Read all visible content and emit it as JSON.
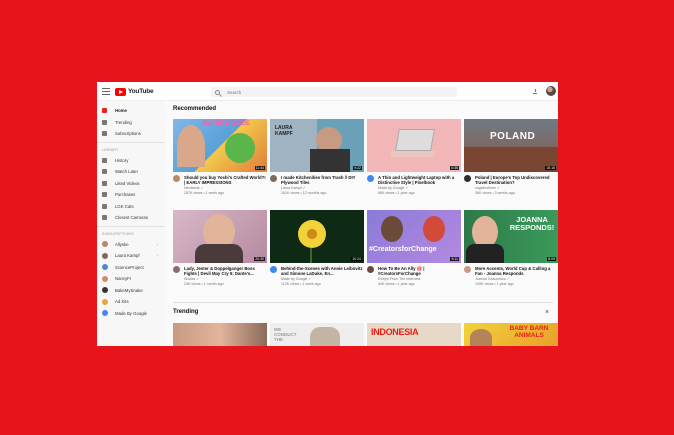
{
  "app": {
    "logo_text": "YouTube"
  },
  "search": {
    "placeholder": "Search"
  },
  "sidebar": {
    "main": [
      "Home",
      "Trending",
      "Subscriptions"
    ],
    "library_heading": "LIBRARY",
    "library": [
      "History",
      "Watch Later",
      "Liked Videos",
      "Purchases",
      "LGK Cats",
      "Closest Cameras"
    ],
    "subscriptions_heading": "SUBSCRIPTIONS",
    "subscriptions": [
      "Allyske",
      "Laura Kampf",
      "ScienceProject",
      "NancyFI",
      "BakeMySnake",
      "Ad Kits",
      "Made By Google"
    ]
  },
  "recommended": {
    "title": "Recommended",
    "videos": [
      {
        "title": "Should you buy Yoshi's Crafted World?! | EARLY IMPRESSIONS",
        "channel": "Nerdtanie ✓",
        "stats": "287K views • 1 week ago",
        "duration": "11:44",
        "thumb_text": "BUYER'S GUIDE"
      },
      {
        "title": "I made Kitchenities from Trash // DIY Plywood Tiles",
        "channel": "Laura Kampf ✓",
        "stats": "161K views • 12 months ago",
        "duration": "9:22",
        "thumb_text": "LAURA KAMPF"
      },
      {
        "title": "A Thin and Lightweight Laptop with a Distinctive Style | Pixelbook",
        "channel": "Made by Google ✓",
        "stats": "86K views • 1 year ago",
        "duration": "0:35",
        "thumb_text": ""
      },
      {
        "title": "Poland | Europe's Top Undiscovered Travel Destination?",
        "channel": "vagabrothers ✓",
        "stats": "36K views • 3 weeks ago",
        "duration": "15:16",
        "thumb_text": "POLAND"
      },
      {
        "title": "Lady, Jester & Doppelganger Boss Fights | Devil May Cry 5: Dante's...",
        "channel": "Wodza ✓",
        "stats": "24K views • 1 month ago",
        "duration": "20:30",
        "thumb_text": ""
      },
      {
        "title": "Behind-the-Scenes with Annie Leibovitz and Simone LaDuke, En...",
        "channel": "Made by Google ✓",
        "stats": "112K views • 1 week ago",
        "duration": "10:24",
        "thumb_text": ""
      },
      {
        "title": "How To Be An Ally 🎯 | #CreatorsForChange",
        "channel": "Evelyn From The Internets",
        "stats": "44K views • 1 year ago",
        "duration": "5:11",
        "thumb_text": "#CreatorsforChange"
      },
      {
        "title": "More Accents, World Cup & Calling a Fan - Joanna Responds",
        "channel": "Joanna Ceaucesco ✓",
        "stats": "149K views • 1 year ago",
        "duration": "8:09",
        "thumb_text": "JOANNA RESPONDS!"
      }
    ]
  },
  "trending": {
    "title": "Trending",
    "thumbs": [
      "",
      "WE CONDUCT THE",
      "INDONESIA",
      "BABY BARN ANIMALS"
    ]
  },
  "colors": {
    "accent": "#e62117",
    "page_background": "#e8141b"
  }
}
